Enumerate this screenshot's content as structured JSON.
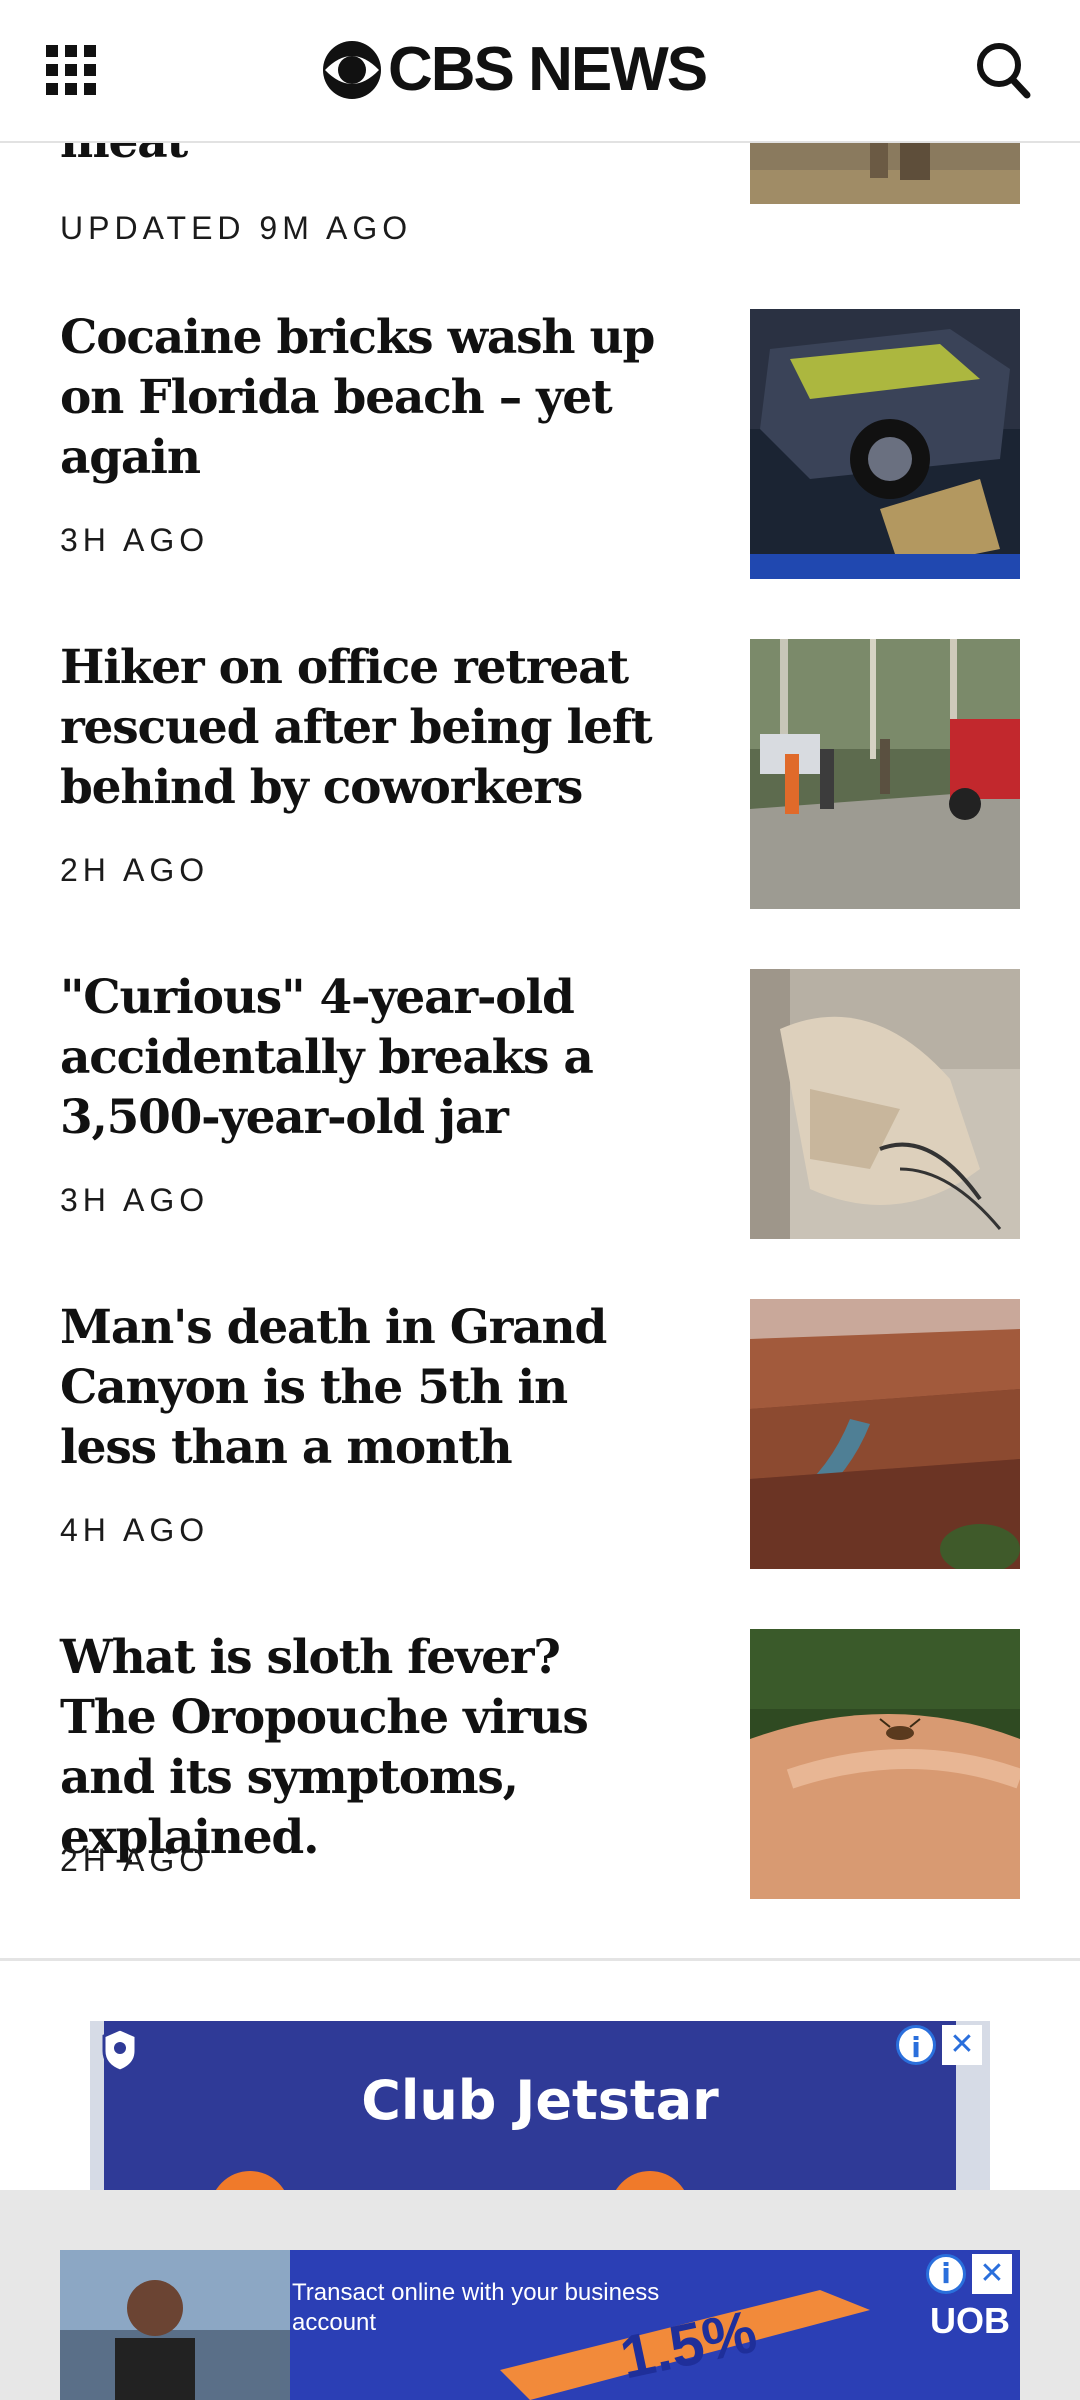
{
  "header": {
    "brand": "CBS NEWS",
    "icons": {
      "menu": "grid-menu-icon",
      "search": "search-icon",
      "logo": "cbs-eye-logo"
    }
  },
  "articles": [
    {
      "headline": "meat",
      "timestamp": "UPDATED 9M AGO"
    },
    {
      "headline": "Cocaine bricks wash up on Florida beach – yet again",
      "timestamp": "3H AGO"
    },
    {
      "headline": "Hiker on office retreat rescued after being left behind by coworkers",
      "timestamp": "2H AGO"
    },
    {
      "headline": "\"Curious\" 4-year-old accidentally breaks a 3,500-year-old jar",
      "timestamp": "3H AGO"
    },
    {
      "headline": "Man's death in Grand Canyon is the 5th in less than a month",
      "timestamp": "4H AGO"
    },
    {
      "headline": "What is sloth fever? The Oropouche virus and its symptoms, explained.",
      "timestamp": "2H AGO"
    }
  ],
  "ads": [
    {
      "title": "Club Jetstar",
      "info_label": "i",
      "close_label": "✕"
    },
    {
      "text": "Transact online with your business account",
      "rate": "1.5%",
      "brand": "UOB",
      "info_label": "i",
      "close_label": "✕"
    }
  ],
  "colors": {
    "text": "#111111",
    "ad_blue": "#2f3a97",
    "divider": "#e4e4e4"
  }
}
